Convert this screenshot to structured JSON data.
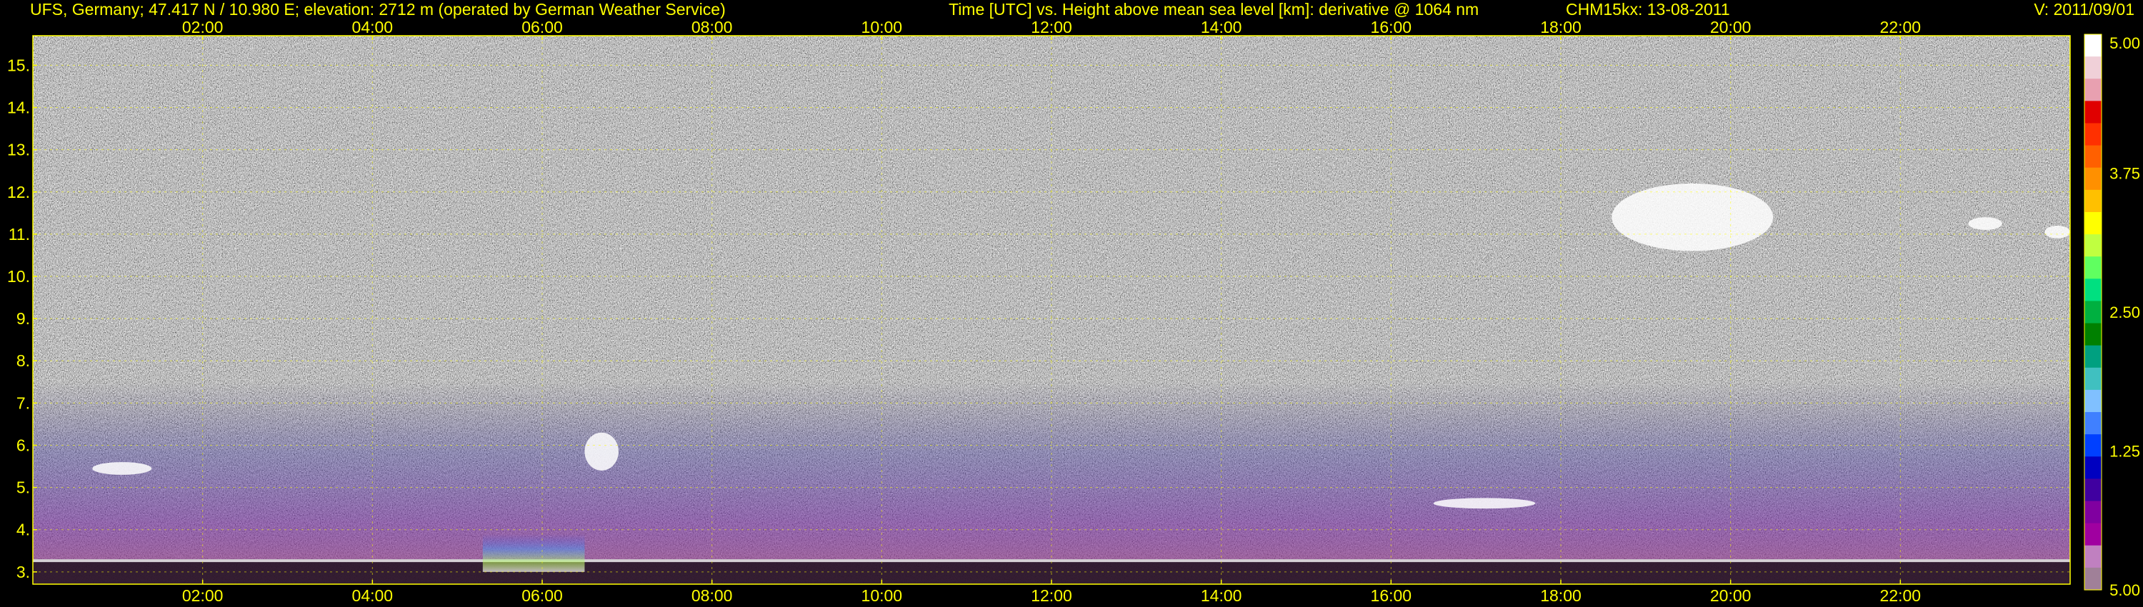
{
  "header": {
    "station": "UFS, Germany; 47.417 N / 10.980 E; elevation: 2712 m  (operated by German Weather Service)",
    "title": "Time [UTC] vs. Height above mean sea level [km]: derivative @ 1064 nm",
    "instrument": "CHM15kx: 13-08-2011",
    "version": "V: 2011/09/01"
  },
  "chart_data": {
    "type": "heatmap",
    "title": "Time [UTC] vs. Height above mean sea level [km]: derivative @ 1064 nm",
    "xlabel": "Time [UTC]",
    "ylabel": "Height above mean sea level [km]",
    "xlim": [
      0,
      24
    ],
    "ylim": [
      2.71,
      15.7
    ],
    "x_ticks": [
      2,
      4,
      6,
      8,
      10,
      12,
      14,
      16,
      18,
      20,
      22
    ],
    "x_tick_labels": [
      "02:00",
      "04:00",
      "06:00",
      "08:00",
      "10:00",
      "12:00",
      "14:00",
      "16:00",
      "18:00",
      "20:00",
      "22:00"
    ],
    "y_ticks": [
      3,
      4,
      5,
      6,
      7,
      8,
      9,
      10,
      11,
      12,
      13,
      14,
      15
    ],
    "y_tick_labels": [
      "3.",
      "4.",
      "5.",
      "6.",
      "7.",
      "8.",
      "9.",
      "10.",
      "11.",
      "12.",
      "13.",
      "14.",
      "15."
    ],
    "grid": true,
    "colorbar": {
      "tick_values": [
        5.0,
        3.75,
        2.5,
        1.25,
        -5.0
      ],
      "tick_labels": [
        "5.00",
        "3.75",
        "2.50",
        "1.25",
        "5.00"
      ],
      "colors": [
        "#ffffff",
        "#f0d0d8",
        "#e8a0b0",
        "#e00000",
        "#ff3000",
        "#ff6000",
        "#ff9000",
        "#ffc000",
        "#ffff00",
        "#c0ff40",
        "#60ff60",
        "#00e080",
        "#00b040",
        "#008000",
        "#00a080",
        "#40c0c0",
        "#80c0ff",
        "#4080ff",
        "#0040ff",
        "#0000c0",
        "#4000a0",
        "#8000a0",
        "#a000a0",
        "#c080c0",
        "#a08098"
      ]
    },
    "features": [
      {
        "name": "low-level aerosol layer",
        "t_start": 0.0,
        "t_end": 24.0,
        "h_bottom": 2.71,
        "h_top": 3.3
      },
      {
        "name": "enhanced aerosol column",
        "t_start": 5.3,
        "t_end": 6.5,
        "h_bottom": 3.0,
        "h_top": 3.9
      },
      {
        "name": "cloud layer",
        "t_start": 0.7,
        "t_end": 1.4,
        "h_bottom": 5.3,
        "h_top": 5.6
      },
      {
        "name": "cloud layer",
        "t_start": 6.5,
        "t_end": 6.9,
        "h_bottom": 5.4,
        "h_top": 6.3
      },
      {
        "name": "cloud layer",
        "t_start": 16.5,
        "t_end": 17.7,
        "h_bottom": 4.5,
        "h_top": 4.75
      },
      {
        "name": "cirrus cloud",
        "t_start": 18.6,
        "t_end": 20.5,
        "h_bottom": 10.6,
        "h_top": 12.2
      },
      {
        "name": "cirrus cloud",
        "t_start": 22.8,
        "t_end": 23.2,
        "h_bottom": 11.1,
        "h_top": 11.4
      },
      {
        "name": "cirrus cloud",
        "t_start": 23.7,
        "t_end": 24.0,
        "h_bottom": 10.9,
        "h_top": 11.2
      }
    ]
  }
}
